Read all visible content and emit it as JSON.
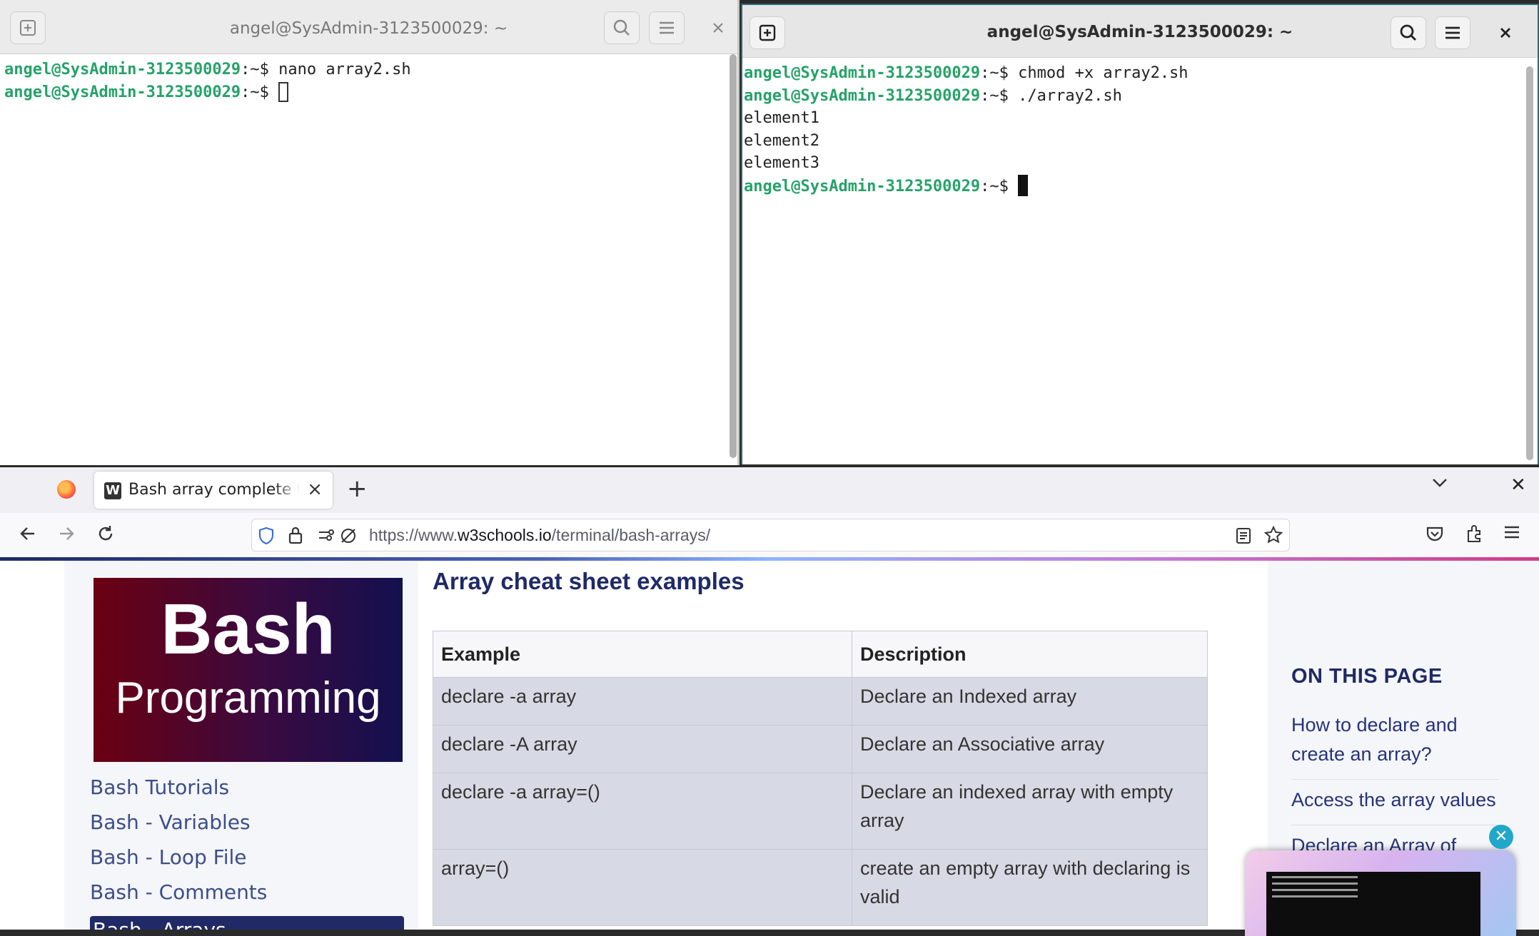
{
  "terminal_left": {
    "title": "angel@SysAdmin-3123500029: ~",
    "lines": [
      {
        "user": "angel@SysAdmin-3123500029",
        "sep": ":~$",
        "cmd": " nano array2.sh"
      },
      {
        "user": "angel@SysAdmin-3123500029",
        "sep": ":~$",
        "cmd": " "
      }
    ]
  },
  "terminal_right": {
    "title": "angel@SysAdmin-3123500029: ~",
    "lines": [
      {
        "user": "angel@SysAdmin-3123500029",
        "sep": ":~$",
        "cmd": " chmod +x array2.sh"
      },
      {
        "user": "angel@SysAdmin-3123500029",
        "sep": ":~$",
        "cmd": " ./array2.sh"
      }
    ],
    "output": [
      "element1",
      "element2",
      "element3"
    ],
    "last_prompt": {
      "user": "angel@SysAdmin-3123500029",
      "sep": ":~$",
      "cmd": " "
    }
  },
  "browser": {
    "tab": {
      "title": "Bash array complete tutorial",
      "favicon": "W"
    },
    "url": {
      "prefix": "https://www.",
      "domain": "w3schools.io",
      "path": "/terminal/bash-arrays/"
    },
    "banner": {
      "title": "Bash",
      "subtitle": "Programming"
    },
    "side_nav": [
      "Bash Tutorials",
      "Bash - Variables",
      "Bash - Loop File",
      "Bash - Comments",
      "Bash - Arrays"
    ],
    "content": {
      "heading": "Array cheat sheet examples",
      "table": {
        "headers": [
          "Example",
          "Description"
        ],
        "rows": [
          [
            "declare -a array",
            "Declare an Indexed array"
          ],
          [
            "declare -A array",
            "Declare an Associative array"
          ],
          [
            "declare -a array=()",
            "Declare an indexed array with empty array"
          ],
          [
            "array=()",
            "create an empty array with declaring is valid"
          ]
        ]
      }
    },
    "toc": {
      "heading": "ON THIS PAGE",
      "items": [
        "How to declare and create an array?",
        "Access the array values",
        "Declare an Array of numbers th"
      ]
    }
  }
}
